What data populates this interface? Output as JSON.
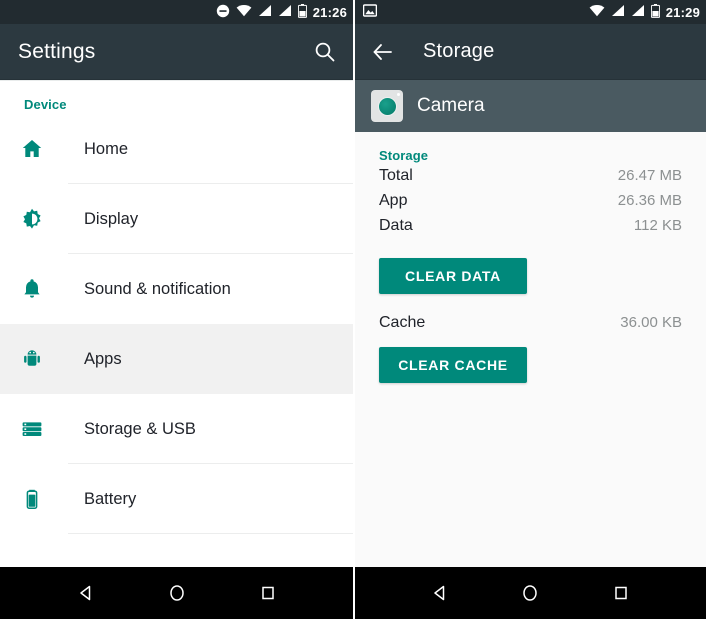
{
  "left_phone": {
    "status_bar": {
      "icons": [
        "do-not-disturb-icon",
        "wifi-icon",
        "signal-1-icon",
        "signal-2-icon",
        "battery-icon"
      ],
      "time": "21:26"
    },
    "toolbar": {
      "title": "Settings",
      "search_icon": "search-icon"
    },
    "section_label": "Device",
    "items": [
      {
        "label": "Home",
        "icon": "home-icon"
      },
      {
        "label": "Display",
        "icon": "brightness-icon"
      },
      {
        "label": "Sound & notification",
        "icon": "bell-icon"
      },
      {
        "label": "Apps",
        "icon": "android-icon",
        "selected": true
      },
      {
        "label": "Storage & USB",
        "icon": "storage-icon"
      },
      {
        "label": "Battery",
        "icon": "battery-icon"
      }
    ],
    "nav_bar": {
      "back": "back-triangle-icon",
      "home": "home-circle-icon",
      "recents": "recents-square-icon"
    }
  },
  "right_phone": {
    "status_bar": {
      "left_icons": [
        "screenshot-image-icon"
      ],
      "icons": [
        "wifi-icon",
        "signal-1-icon",
        "signal-2-icon",
        "battery-icon"
      ],
      "time": "21:29"
    },
    "toolbar": {
      "back_icon": "arrow-back-icon",
      "title": "Storage"
    },
    "app_header": {
      "icon": "camera-app-icon",
      "name": "Camera"
    },
    "section_label": "Storage",
    "details": [
      {
        "key": "Total",
        "value": "26.47 MB"
      },
      {
        "key": "App",
        "value": "26.36 MB"
      },
      {
        "key": "Data",
        "value": "112 KB"
      }
    ],
    "clear_data_label": "CLEAR DATA",
    "cache": {
      "key": "Cache",
      "value": "36.00 KB"
    },
    "clear_cache_label": "CLEAR CACHE",
    "nav_bar": {
      "back": "back-triangle-icon",
      "home": "home-circle-icon",
      "recents": "recents-square-icon"
    }
  },
  "colors": {
    "accent_teal": "#00897b",
    "toolbar_dark": "#2c3940",
    "status_dark": "#222b30",
    "app_header": "#4a5a61",
    "selected_row": "#f1f1f1",
    "value_gray": "#8c9091"
  }
}
